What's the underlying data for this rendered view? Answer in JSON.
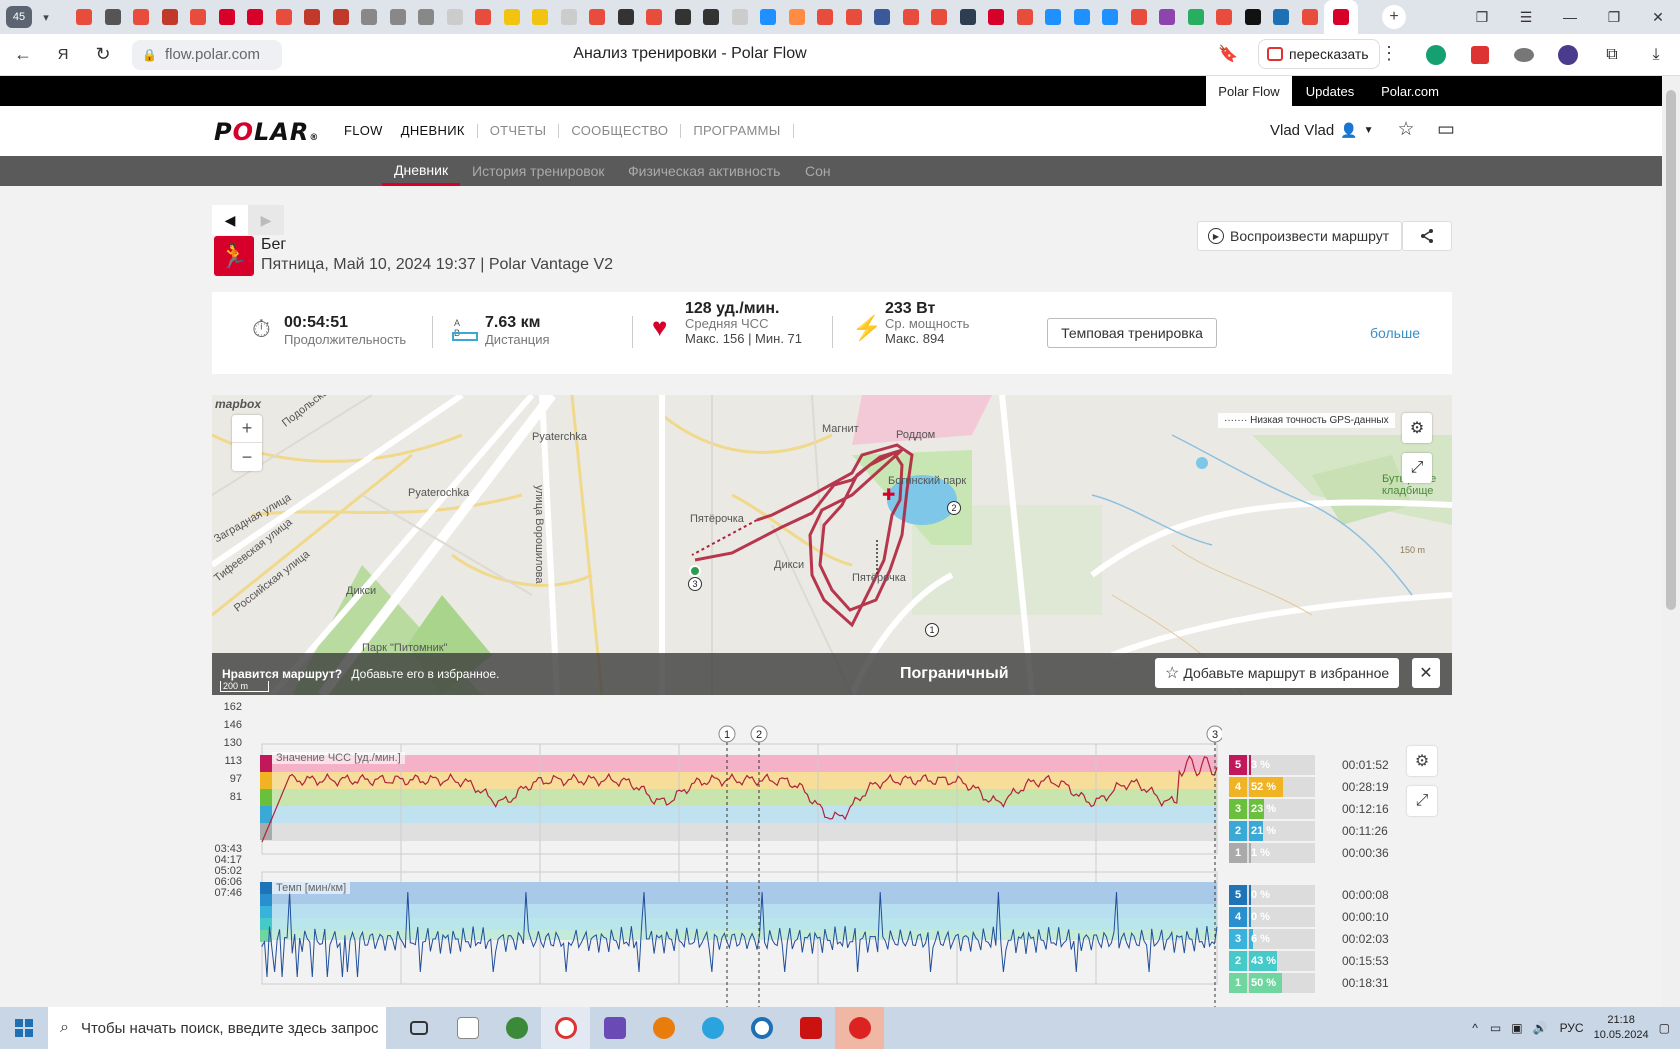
{
  "browser": {
    "tab_count": "45",
    "page_title": "Анализ тренировки - Polar Flow",
    "url": "flow.polar.com",
    "retell_label": "пересказать",
    "tab_colors": [
      "#e84c3d",
      "#555",
      "#e84c3d",
      "#c0392b",
      "#e84c3d",
      "#d6002a",
      "#d6002a",
      "#e84c3d",
      "#c0392b",
      "#c0392b",
      "#888",
      "#888",
      "#888",
      "#ccc",
      "#e84c3d",
      "#f1c40f",
      "#f1c40f",
      "#ccc",
      "#e84c3d",
      "#333",
      "#e84c3d",
      "#333",
      "#333",
      "#ccc",
      "#1e90ff",
      "#ff8c42",
      "#e84c3d",
      "#e84c3d",
      "#3b5998",
      "#e84c3d",
      "#e84c3d",
      "#2c3e50",
      "#d6002a",
      "#e84c3d",
      "#1e90ff",
      "#1e90ff",
      "#1e90ff",
      "#e84c3d",
      "#8e44ad",
      "#27ae60",
      "#e84c3d",
      "#111",
      "#1e6fb3",
      "#e84c3d",
      "#d6002a"
    ]
  },
  "polar_tabs": [
    "Polar Flow",
    "Updates",
    "Polar.com"
  ],
  "header": {
    "flow_label": "FLOW",
    "nav": [
      "ДНЕВНИК",
      "ОТЧЕТЫ",
      "СООБЩЕСТВО",
      "ПРОГРАММЫ"
    ],
    "user": "Vlad Vlad"
  },
  "subnav": [
    "Дневник",
    "История тренировок",
    "Физическая активность",
    "Сон"
  ],
  "session": {
    "sport": "Бег",
    "date": "Пятница, Май 10, 2024 19:37 | Polar Vantage V2",
    "replay_label": "Воспроизвести маршрут"
  },
  "summary": {
    "duration": "00:54:51",
    "duration_label": "Продолжительность",
    "distance": "7.63 км",
    "distance_label": "Дистанция",
    "distance_ab": "A B",
    "hr_avg": "128 уд./мин.",
    "hr_label": "Средняя ЧСС",
    "hr_maxmin": "Макс. 156 | Мин. 71",
    "power": "233 Вт",
    "power_label": "Ср. мощность",
    "power_max": "Макс. 894",
    "training_type": "Темповая тренировка",
    "more": "больше"
  },
  "map": {
    "legend": "Низкая точность GPS-данных",
    "like_q": "Нравится маршрут?",
    "like_text": "Добавьте его в избранное.",
    "fav_button": "Добавьте маршрут в избранное",
    "scale": "200 m",
    "mapbox": "mapbox",
    "labels": {
      "magnit": "Магнит",
      "roddom": "Роддом",
      "pyaterchka_top": "Pyaterchka",
      "pyaterochka_left": "Pyaterochka",
      "pyaterochka_mid": "Пятёрочка",
      "dixy_mid": "Дикси",
      "dixy_left": "Дикси",
      "park_pitomnik": "Парк \"Питомник\"",
      "park_bog": "Богинский парк",
      "pyaterochka_low": "Пятёрочка",
      "cemetery": "Бутырское кладбище",
      "street": "улица Ворошилова",
      "district": "Пограничный",
      "st1": "Подольская",
      "st2": "Российская улица",
      "st3": "Тифеевская улица",
      "st4": "Заградная улица",
      "elev": "150 m"
    },
    "markers": [
      "1",
      "2",
      "3"
    ]
  },
  "hr_chart": {
    "title": "Значение ЧСС [уд./мин.]",
    "yticks": [
      "162",
      "146",
      "130",
      "113",
      "97",
      "81"
    ],
    "zones": [
      {
        "zone": "5",
        "pct": "3 %",
        "pct_value": 3,
        "time": "00:01:52",
        "color": "#c2185b"
      },
      {
        "zone": "4",
        "pct": "52 %",
        "pct_value": 52,
        "time": "00:28:19",
        "color": "#f0b323"
      },
      {
        "zone": "3",
        "pct": "23 %",
        "pct_value": 23,
        "time": "00:12:16",
        "color": "#6abf3c"
      },
      {
        "zone": "2",
        "pct": "21 %",
        "pct_value": 21,
        "time": "00:11:26",
        "color": "#3aa9d6"
      },
      {
        "zone": "1",
        "pct": "1 %",
        "pct_value": 1,
        "time": "00:00:36",
        "color": "#aaaaaa"
      }
    ]
  },
  "pace_chart": {
    "title": "Темп [мин/км]",
    "yticks": [
      "03:43",
      "04:17",
      "05:02",
      "06:06",
      "07:46"
    ],
    "zones": [
      {
        "zone": "5",
        "pct": "0 %",
        "pct_value": 0,
        "time": "00:00:08",
        "color": "#1f73b7"
      },
      {
        "zone": "4",
        "pct": "0 %",
        "pct_value": 0,
        "time": "00:00:10",
        "color": "#2a8fcf"
      },
      {
        "zone": "3",
        "pct": "6 %",
        "pct_value": 6,
        "time": "00:02:03",
        "color": "#3ab3dc"
      },
      {
        "zone": "2",
        "pct": "43 %",
        "pct_value": 43,
        "time": "00:15:53",
        "color": "#46c9c9"
      },
      {
        "zone": "1",
        "pct": "50 %",
        "pct_value": 50,
        "time": "00:18:31",
        "color": "#6fd6a0"
      }
    ]
  },
  "lap_markers": [
    "1",
    "2",
    "3"
  ],
  "taskbar": {
    "search_placeholder": "Чтобы начать поиск, введите здесь запрос",
    "lang": "РУС",
    "time": "21:18",
    "date": "10.05.2024"
  }
}
